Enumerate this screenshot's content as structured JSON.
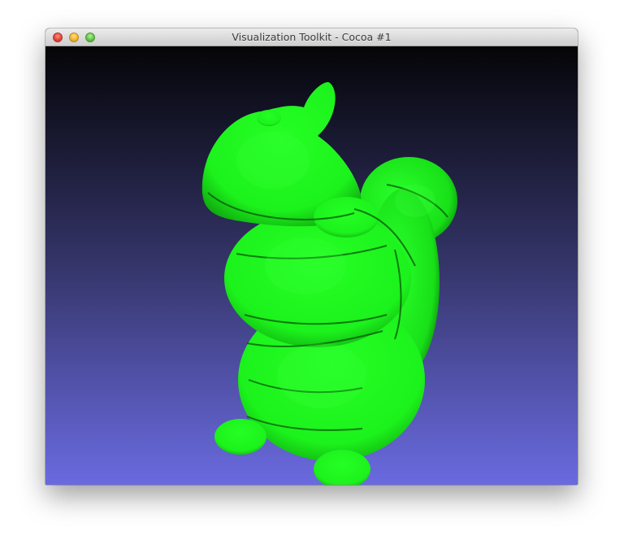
{
  "window": {
    "title": "Visualization Toolkit - Cocoa #1"
  },
  "traffic_lights": [
    "close-icon",
    "minimize-icon",
    "zoom-icon"
  ],
  "viewport": {
    "background_top": "#050508",
    "background_bottom": "#6a6ae0",
    "model": "squirrel-model",
    "model_color": "#1cf21c"
  }
}
